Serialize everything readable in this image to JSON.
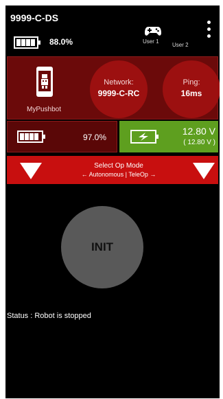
{
  "app": {
    "title": "9999-C-DS"
  },
  "header": {
    "ds_battery": "88.0%",
    "user1_label": "User 1",
    "user2_label": "User 2",
    "gamepad_icon": "gamepad-icon",
    "menu_icon": "overflow-menu-icon"
  },
  "robot_panel": {
    "robot_name": "MyPushbot",
    "network_label": "Network:",
    "network_value": "9999-C-RC",
    "ping_label": "Ping:",
    "ping_value": "16ms"
  },
  "battery_row": {
    "rc_battery": "97.0%",
    "robot_voltage": "12.80 V",
    "robot_voltage_sub": "( 12.80 V )"
  },
  "opmode": {
    "title": "Select Op Mode",
    "subtitle": "← Autonomous | TeleOp →"
  },
  "init_button": {
    "label": "INIT"
  },
  "status": {
    "text": "Status : Robot is stopped"
  },
  "colors": {
    "panel_dark_red": "#6b0a0a",
    "circle_red": "#9c1010",
    "opmode_red": "#c80f0f",
    "voltage_green": "#5e9f1f",
    "init_gray": "#595959"
  }
}
